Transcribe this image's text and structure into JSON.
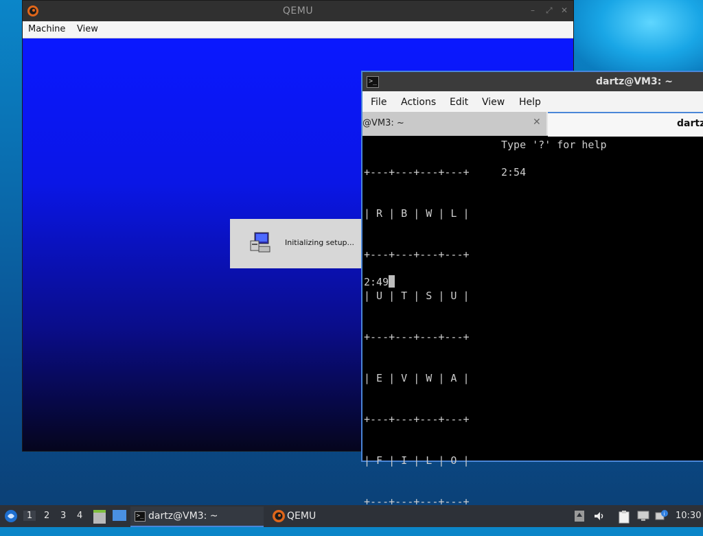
{
  "qemu": {
    "title": "QEMU",
    "menu": [
      "Machine",
      "View"
    ],
    "dialog_message": "Initializing setup..."
  },
  "terminal": {
    "title": "dartz@VM3: ~",
    "menu": [
      "File",
      "Actions",
      "Edit",
      "View",
      "Help"
    ],
    "tabs": [
      {
        "label": "@VM3: ~",
        "active": false
      },
      {
        "label": "dartz",
        "active": true
      }
    ],
    "grid_rows": [
      "+---+---+---+---+",
      "| R | B | W | L |",
      "+---+---+---+---+",
      "| U | T | S | U |",
      "+---+---+---+---+",
      "| E | V | W | A |",
      "+---+---+---+---+",
      "| F | I | L | O |",
      "+---+---+---+---+"
    ],
    "help_text": "Type '?' for help",
    "timer_right": "2:54",
    "timer_prompt": "2:49"
  },
  "taskbar": {
    "workspaces": [
      "1",
      "2",
      "3",
      "4"
    ],
    "active_workspace": "1",
    "tasks": [
      {
        "label": "dartz@VM3: ~",
        "icon": "terminal-icon",
        "active": true
      },
      {
        "label": "QEMU",
        "icon": "qemu-icon",
        "active": false
      }
    ],
    "clock": "10:30"
  },
  "colors": {
    "accent": "#4a86d8",
    "qemu_screen_top": "#0a18ff",
    "taskbar": "#2d3138"
  }
}
